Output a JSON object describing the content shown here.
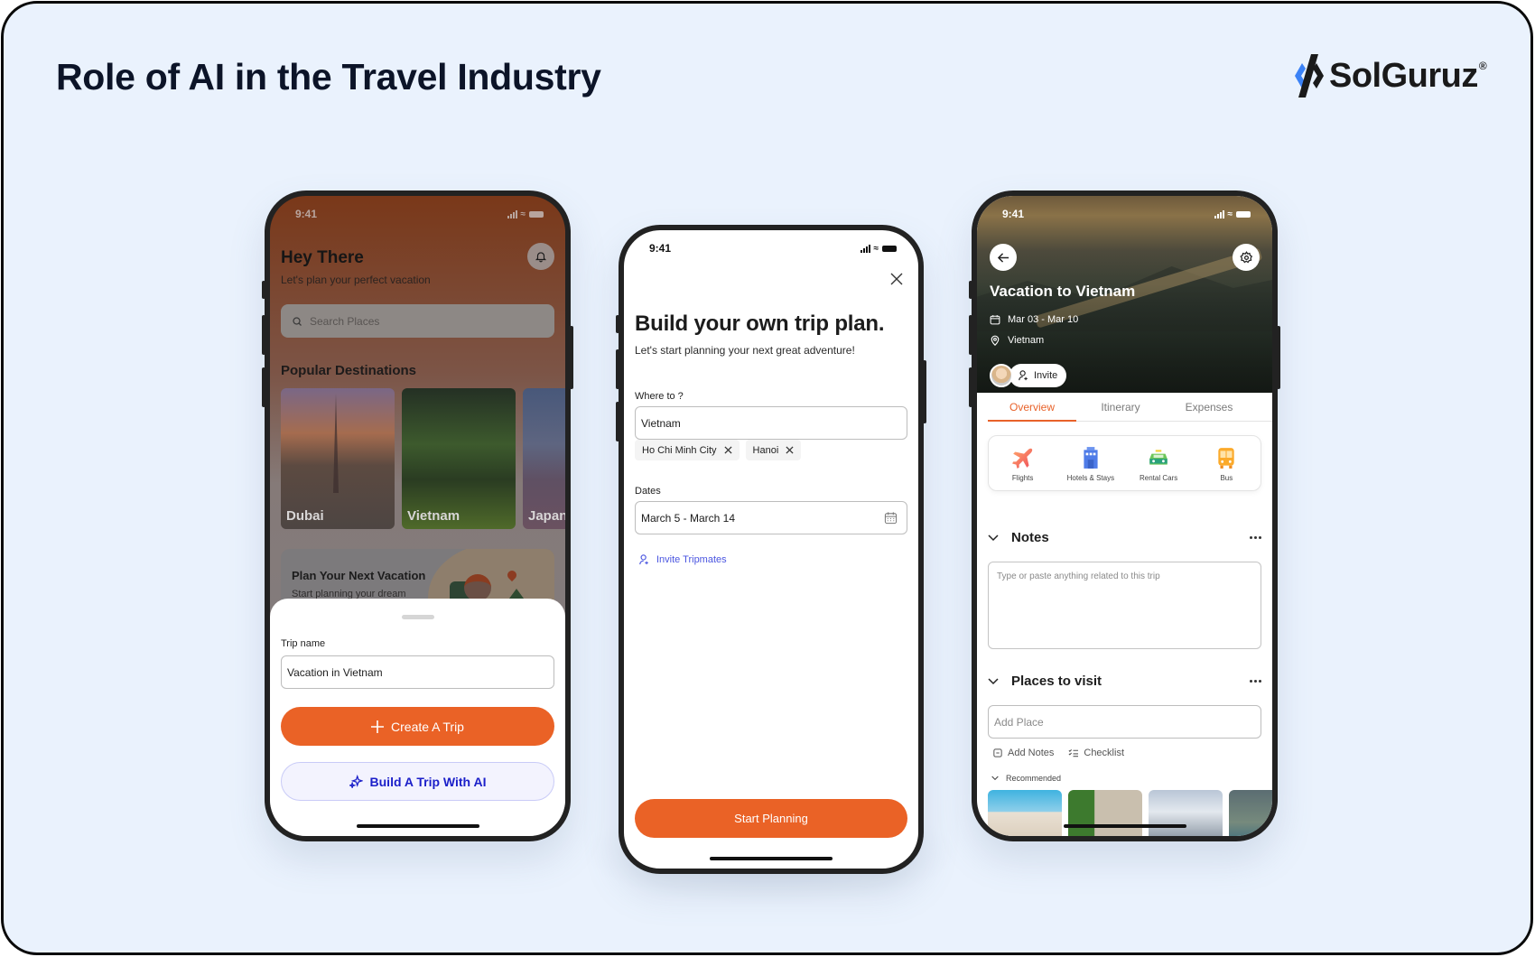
{
  "page": {
    "title": "Role of AI in the Travel Industry",
    "brand": {
      "name": "SolGuruz",
      "registered_mark": "®",
      "colors": {
        "accent": "#3b82f6",
        "dark": "#1a1a1a"
      }
    }
  },
  "colors": {
    "primary_orange": "#ea6226",
    "ai_blue": "#1b1fc9",
    "link_blue": "#4a55e0",
    "background": "#eaf2fd"
  },
  "phone_home": {
    "status_time": "9:41",
    "greeting": "Hey There",
    "subtitle": "Let's plan your perfect vacation",
    "search_placeholder": "Search Places",
    "popular_heading": "Popular Destinations",
    "destinations": [
      {
        "name": "Dubai"
      },
      {
        "name": "Vietnam"
      },
      {
        "name": "Japan"
      }
    ],
    "plan_card": {
      "title": "Plan Your Next Vacation",
      "subtitle": "Start planning your dream"
    },
    "sheet": {
      "trip_name_label": "Trip name",
      "trip_name_value": "Vacation in Vietnam",
      "create_button": "Create A Trip",
      "ai_button": "Build A Trip With AI"
    }
  },
  "phone_builder": {
    "status_time": "9:41",
    "title": "Build your own trip plan.",
    "subtitle": "Let's start planning your next great adventure!",
    "where_label": "Where to ?",
    "where_value": "Vietnam",
    "chips": [
      {
        "label": "Ho Chi Minh City"
      },
      {
        "label": "Hanoi"
      }
    ],
    "dates_label": "Dates",
    "dates_value": "March 5 - March 14",
    "invite_link": "Invite Tripmates",
    "start_button": "Start Planning"
  },
  "phone_trip": {
    "status_time": "9:41",
    "title": "Vacation to Vietnam",
    "dates": "Mar 03 - Mar 10",
    "location": "Vietnam",
    "invite_button": "Invite",
    "tabs": [
      {
        "label": "Overview",
        "active": true
      },
      {
        "label": "Itinerary"
      },
      {
        "label": "Expenses"
      }
    ],
    "categories": [
      {
        "label": "Flights",
        "icon": "airplane-icon"
      },
      {
        "label": "Hotels & Stays",
        "icon": "hotel-icon"
      },
      {
        "label": "Rental Cars",
        "icon": "taxi-icon"
      },
      {
        "label": "Bus",
        "icon": "bus-icon"
      }
    ],
    "notes_heading": "Notes",
    "notes_placeholder": "Type or paste anything related to this trip",
    "places_heading": "Places to visit",
    "add_place_placeholder": "Add Place",
    "add_notes": "Add Notes",
    "checklist": "Checklist",
    "recommended": "Recommended"
  }
}
